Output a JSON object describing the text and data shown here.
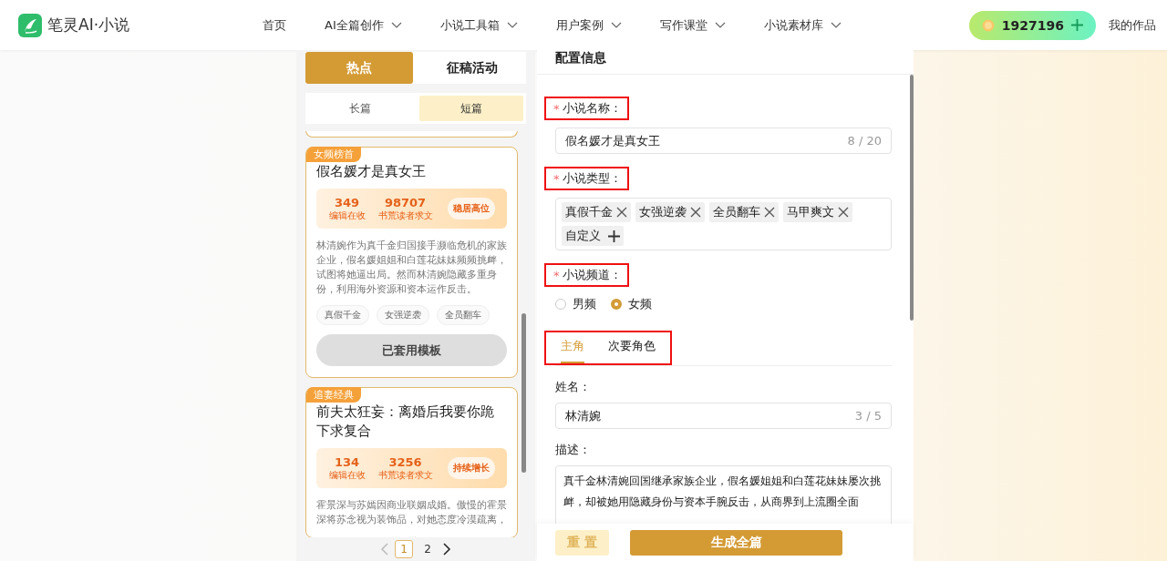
{
  "header": {
    "logo_text": "笔灵AI·小说",
    "nav": [
      {
        "label": "首页",
        "dropdown": false
      },
      {
        "label": "AI全篇创作",
        "dropdown": true
      },
      {
        "label": "小说工具箱",
        "dropdown": true
      },
      {
        "label": "用户案例",
        "dropdown": true
      },
      {
        "label": "写作课堂",
        "dropdown": true
      },
      {
        "label": "小说素材库",
        "dropdown": true
      }
    ],
    "coins": "1927196",
    "my_works": "我的作品"
  },
  "left_panel": {
    "tabs": [
      {
        "label": "热点",
        "selected": true
      },
      {
        "label": "征稿活动",
        "selected": false
      }
    ],
    "length_tabs": [
      {
        "label": "长篇",
        "selected": false
      },
      {
        "label": "短篇",
        "selected": true
      }
    ],
    "cards": [
      {
        "badge": "女频榜首",
        "title": "假名媛才是真女王",
        "stats": [
          {
            "value": "349",
            "label": "编辑在收"
          },
          {
            "value": "98707",
            "label": "书荒读者求文"
          }
        ],
        "trend": "稳居高位",
        "description": "林清婉作为真千金归国接手濒临危机的家族企业，假名媛姐姐和白莲花妹妹频频挑衅，试图将她逼出局。然而林清婉隐藏多重身份，利用海外资源和资本运作反击。",
        "tags": [
          "真假千金",
          "女强逆袭",
          "全员翻车"
        ],
        "action": "已套用模板"
      },
      {
        "badge": "追妻经典",
        "title": "前夫太狂妄：离婚后我要你跪下求复合",
        "stats": [
          {
            "value": "134",
            "label": "编辑在收"
          },
          {
            "value": "3256",
            "label": "书荒读者求文"
          }
        ],
        "trend": "持续增长",
        "description": "霍景深与苏嫣因商业联姻成婚。傲慢的霍景深将苏念视为装饰品，对她态度冷漠疏离，"
      }
    ],
    "pagination": [
      {
        "label": "1",
        "selected": true
      },
      {
        "label": "2",
        "selected": false
      }
    ]
  },
  "config": {
    "title": "配置信息",
    "fields": [
      {
        "kind": "text",
        "required_mark": "*",
        "label": "小说名称：",
        "highlighted": true,
        "value": "假名媛才是真女王",
        "counter": "8 / 20"
      },
      {
        "kind": "tags",
        "required_mark": "*",
        "label": "小说类型：",
        "highlighted": true,
        "tags": [
          "真假千金",
          "女强逆袭",
          "全员翻车",
          "马甲爽文"
        ],
        "custom": "自定义"
      },
      {
        "kind": "radio",
        "required_mark": "*",
        "label": "小说频道：",
        "highlighted": true,
        "options": [
          {
            "label": "男频",
            "selected": false
          },
          {
            "label": "女频",
            "selected": true
          }
        ]
      }
    ],
    "role_tabs": {
      "highlighted": true,
      "tabs": [
        {
          "label": "主角",
          "selected": true
        },
        {
          "label": "次要角色",
          "selected": false
        }
      ]
    },
    "name": {
      "label": "姓名：",
      "value": "林清婉",
      "counter": "3 / 5"
    },
    "description": {
      "label": "描述：",
      "value": "真千金林清婉回国继承家族企业，假名媛姐姐和白莲花妹妹屡次挑衅，却被她用隐藏身份与资本手腕反击，从商界到上流圈全面"
    },
    "buttons": [
      {
        "kind": "secondary",
        "label": "重 置"
      },
      {
        "kind": "primary",
        "label": "生成全篇"
      }
    ]
  }
}
